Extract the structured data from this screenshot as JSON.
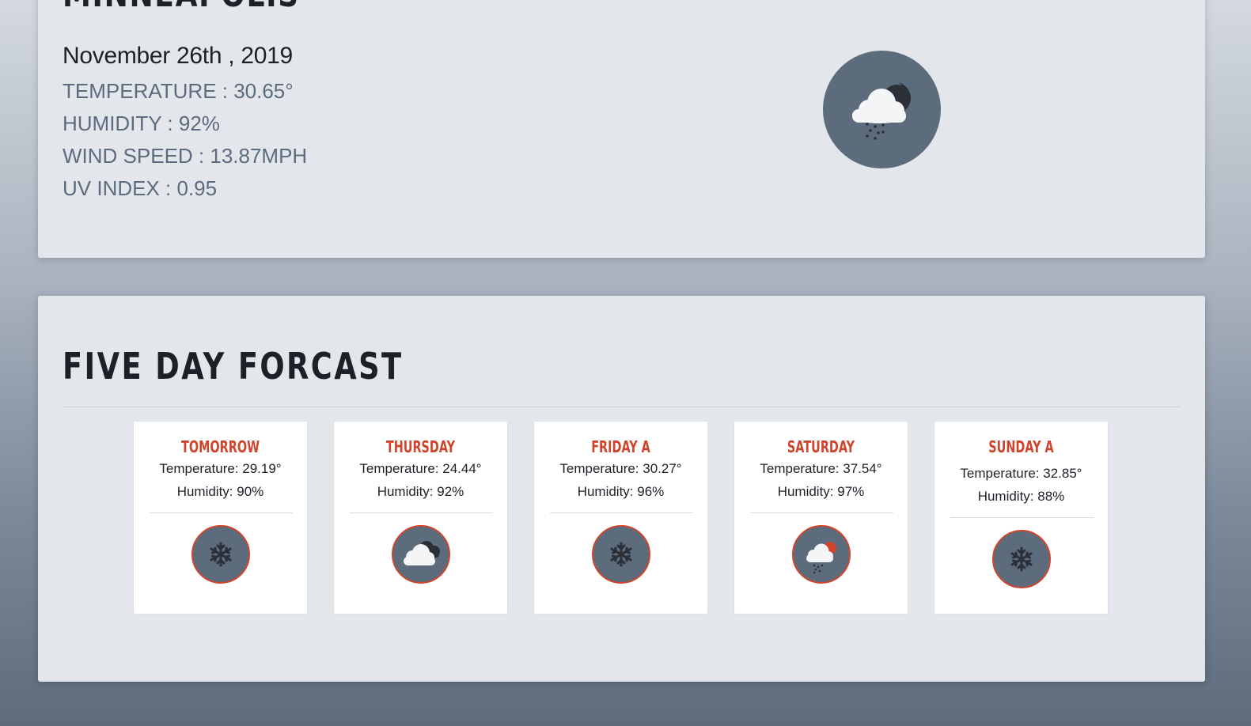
{
  "current": {
    "city": "MINNEAPOLIS",
    "date": "November 26th , 2019",
    "temperature": "TEMPERATURE : 30.65°",
    "humidity": "HUMIDITY : 92%",
    "wind_speed": "WIND SPEED : 13.87MPH",
    "uv_index": "UV  INDEX : 0.95",
    "icon": "snow-cloud-night-icon"
  },
  "forecast": {
    "title": "FIVE DAY FORCAST",
    "days": [
      {
        "name": "TOMORROW",
        "temperature": "Temperature: 29.19°",
        "humidity": "Humidity: 90%",
        "icon": "snowflake-icon"
      },
      {
        "name": "THURSDAY",
        "temperature": "Temperature: 24.44°",
        "humidity": "Humidity: 92%",
        "icon": "cloudy-icon"
      },
      {
        "name": "FRIDAY A",
        "temperature": "Temperature: 30.27°",
        "humidity": "Humidity: 96%",
        "icon": "snowflake-icon"
      },
      {
        "name": "SATURDAY",
        "temperature": "Temperature: 37.54°",
        "humidity": "Humidity: 97%",
        "icon": "snow-cloud-sun-icon"
      },
      {
        "name": "SUNDAY A",
        "temperature": "Temperature: 32.85°",
        "humidity": "Humidity: 88%",
        "icon": "snowflake-icon"
      }
    ]
  },
  "colors": {
    "accent": "#d0442c",
    "icon_bg": "#5d6c7d",
    "card_bg": "#e3e7ec",
    "muted_text": "#5c6b7e"
  }
}
